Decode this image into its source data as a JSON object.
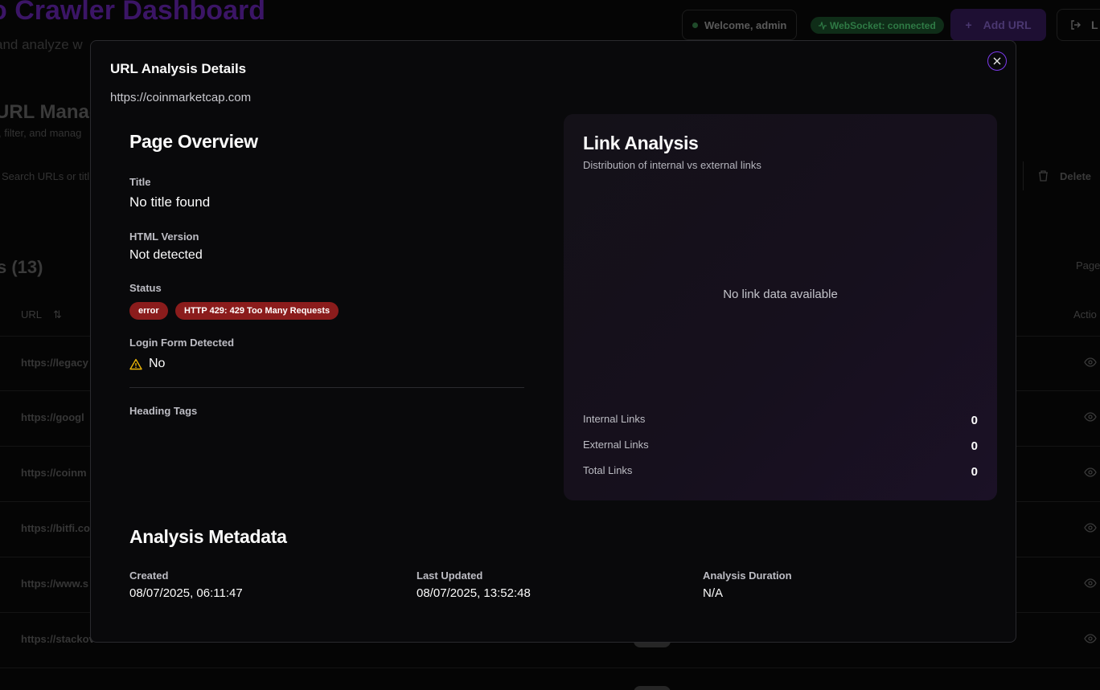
{
  "background": {
    "app_title": "o Crawler Dashboard",
    "app_subtitle": "and analyze w",
    "welcome": "Welcome, admin",
    "websocket": "WebSocket: connected",
    "add_url": "Add URL",
    "logout": "L",
    "section_title": "URL Manage",
    "section_subtitle": ", filter, and manag",
    "search_placeholder": "Search URLs or titl",
    "delete_label": "Delete",
    "count_label": "s (13)",
    "page_label": "Page",
    "col_url": "URL",
    "col_actions": "Actio",
    "rows": [
      {
        "url": "https://legacy"
      },
      {
        "url": "https://googl"
      },
      {
        "url": "https://coinm"
      },
      {
        "url": "https://bitfi.co"
      },
      {
        "url": "https://www.s"
      },
      {
        "url": "https://stackov"
      }
    ]
  },
  "modal": {
    "title": "URL Analysis Details",
    "url": "https://coinmarketcap.com",
    "close_icon": "close-icon",
    "overview": {
      "heading": "Page Overview",
      "title_label": "Title",
      "title_value": "No title found",
      "html_label": "HTML Version",
      "html_value": "Not detected",
      "status_label": "Status",
      "status_badge": "error",
      "status_detail": "HTTP 429: 429 Too Many Requests",
      "login_label": "Login Form Detected",
      "login_value": "No",
      "headings_label": "Heading Tags"
    },
    "links": {
      "heading": "Link Analysis",
      "subtitle": "Distribution of internal vs external links",
      "empty": "No link data available",
      "internal_label": "Internal Links",
      "internal_value": "0",
      "external_label": "External Links",
      "external_value": "0",
      "total_label": "Total Links",
      "total_value": "0"
    },
    "metadata": {
      "heading": "Analysis Metadata",
      "created_label": "Created",
      "created_value": "08/07/2025, 06:11:47",
      "updated_label": "Last Updated",
      "updated_value": "08/07/2025, 13:52:48",
      "duration_label": "Analysis Duration",
      "duration_value": "N/A"
    }
  },
  "colors": {
    "accent": "#7c3aed",
    "error_badge": "#8b1c1c",
    "warning": "#eab308"
  }
}
